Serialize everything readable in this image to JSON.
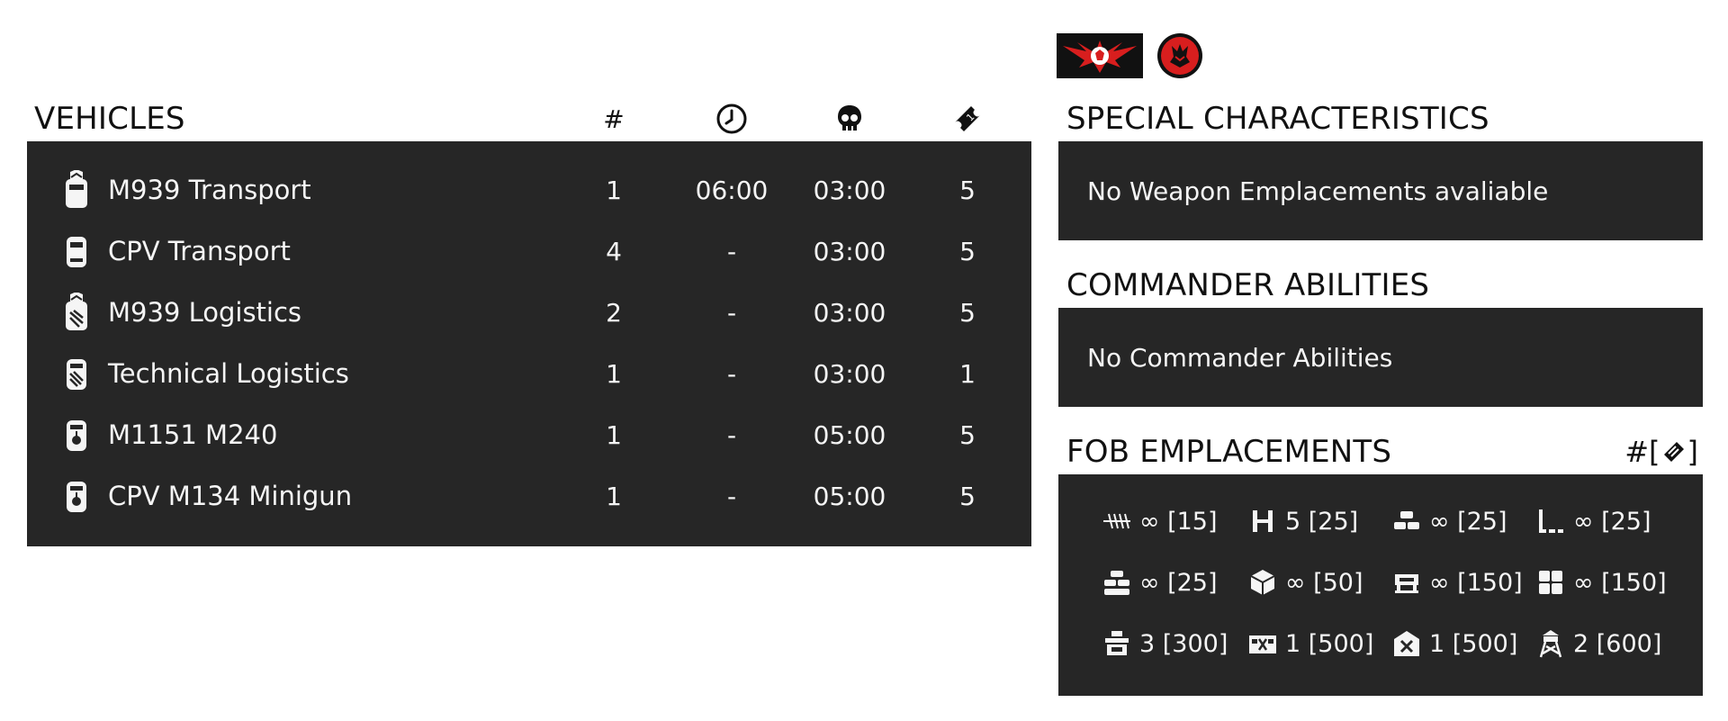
{
  "vehicles": {
    "title": "VEHICLES",
    "headers": {
      "count": "#",
      "delay_icon": "clock-icon",
      "respawn_icon": "skull-icon",
      "tickets_icon": "ticket-icon"
    },
    "rows": [
      {
        "name": "M939 Transport",
        "count": "1",
        "delay": "06:00",
        "respawn": "03:00",
        "tickets": "5",
        "icon": "transport-truck-icon"
      },
      {
        "name": "CPV Transport",
        "count": "4",
        "delay": "-",
        "respawn": "03:00",
        "tickets": "5",
        "icon": "transport-car-icon"
      },
      {
        "name": "M939 Logistics",
        "count": "2",
        "delay": "-",
        "respawn": "03:00",
        "tickets": "5",
        "icon": "logistics-truck-icon"
      },
      {
        "name": "Technical Logistics",
        "count": "1",
        "delay": "-",
        "respawn": "03:00",
        "tickets": "1",
        "icon": "logistics-car-icon"
      },
      {
        "name": "M1151 M240",
        "count": "1",
        "delay": "-",
        "respawn": "05:00",
        "tickets": "5",
        "icon": "armed-car-icon"
      },
      {
        "name": "CPV M134 Minigun",
        "count": "1",
        "delay": "-",
        "respawn": "05:00",
        "tickets": "5",
        "icon": "armed-car-icon"
      }
    ]
  },
  "special": {
    "title": "SPECIAL CHARACTERISTICS",
    "message": "No Weapon Emplacements avaliable"
  },
  "commander": {
    "title": "COMMANDER ABILITIES",
    "message": "No Commander Abilities"
  },
  "fob": {
    "title": "FOB EMPLACEMENTS",
    "legend_prefix": "#[",
    "legend_icon": "construction-icon",
    "legend_suffix": "]",
    "items": [
      {
        "icon": "razor-wire-icon",
        "label": "∞ [15]"
      },
      {
        "icon": "barrier-icon",
        "label": "5 [25]"
      },
      {
        "icon": "sandbag-icon",
        "label": "∞ [25]"
      },
      {
        "icon": "trench-icon",
        "label": "∞ [25]"
      },
      {
        "icon": "sandbag-wall-icon",
        "label": "∞ [25]"
      },
      {
        "icon": "ammo-crate-icon",
        "label": "∞ [50]"
      },
      {
        "icon": "bench-icon",
        "label": "∞ [150]"
      },
      {
        "icon": "hesco-icon",
        "label": "∞ [150]"
      },
      {
        "icon": "bunker-icon",
        "label": "3 [300]"
      },
      {
        "icon": "hab-icon",
        "label": "1 [500]"
      },
      {
        "icon": "vehicle-repair-icon",
        "label": "1 [500]"
      },
      {
        "icon": "watchtower-icon",
        "label": "2 [600]"
      }
    ]
  },
  "logos": {
    "left": "faction-eagle-logo",
    "right": "unit-wolf-logo"
  },
  "colors": {
    "panel": "#262626",
    "text_light": "#f5f5f5",
    "logo_red": "#d81e1e"
  }
}
